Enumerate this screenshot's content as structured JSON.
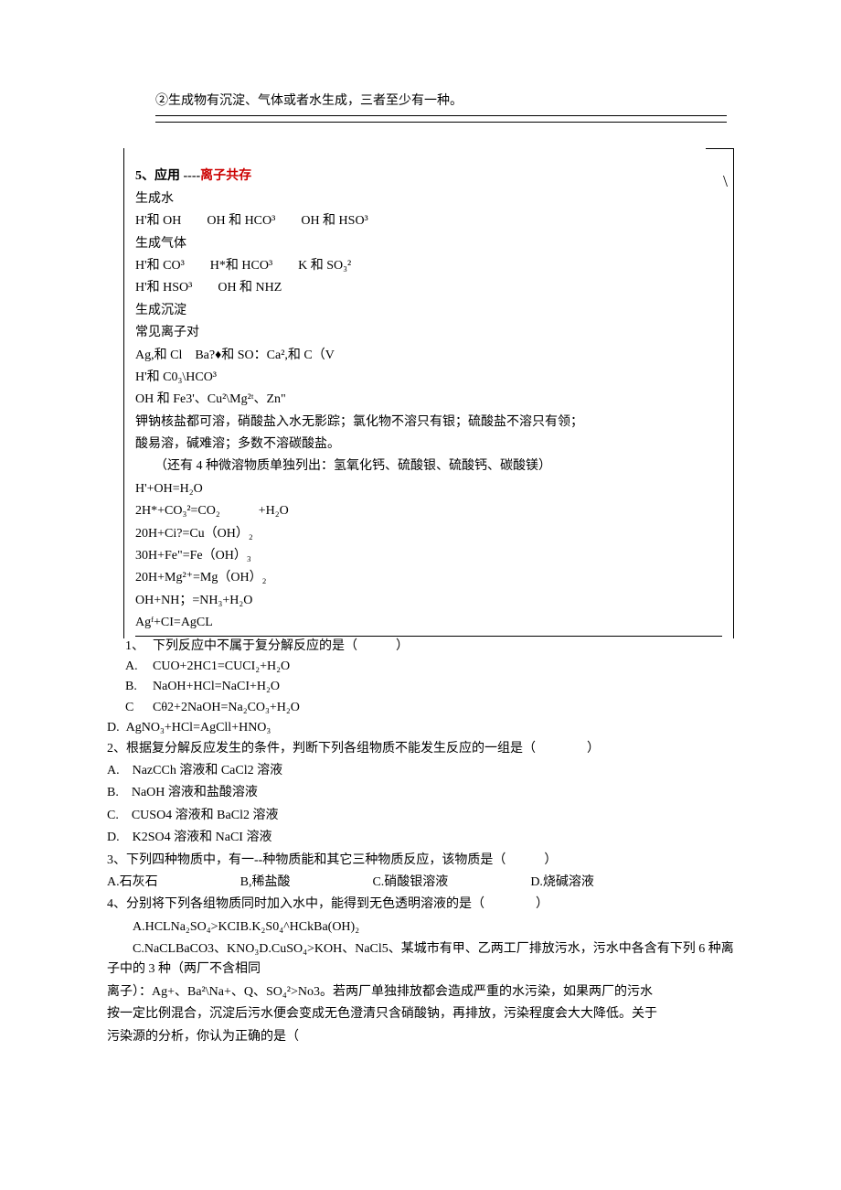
{
  "top_line": "②生成物有沉淀、气体或者水生成，三者至少有一种。",
  "box": {
    "title_prefix": "5、应用 ----",
    "title_red": "离子共存",
    "slash": "\\",
    "l1": "生成水",
    "l2": "H'和 OH　　OH 和 HCO³　　OH 和 HSO³",
    "l3": "生成气体",
    "l4": "H'和 CO³　　H*和 HCO³　　K 和 SO₃²",
    "l5": "H'和 HSO³　　OH 和 NHZ",
    "l6": "生成沉淀",
    "l7": "常见离子对",
    "l8": "Ag,和 Cl　Ba?♦和 SO：Ca²,和 C（V",
    "l9": "H'和 C0₃\\HCO³",
    "l10": "OH 和 Fe3'、Cu²\\Mg²ᵗ、Zn\"",
    "l11": "钾钠核盐都可溶，硝酸盐入水无影踪；氯化物不溶只有银；硫酸盐不溶只有领；",
    "l12": "酸易溶，碱难溶；多数不溶碳酸盐。",
    "l13": "　　（还有 4 种微溶物质单独列出：氢氧化钙、硫酸银、硫酸钙、碳酸镁）",
    "l14": "H'+OH=H₂O",
    "l15": "2H*+CO₃²=CO₂　　　+H₂O",
    "l16": "20H+Ci?=Cu（OH）₂",
    "l17": "30H+Fe\"=Fe（OH）₃",
    "l18": "20H+Mg²⁺=Mg（OH）₂",
    "l19": "OH+NH；=NH₃+H₂O",
    "l20": "Agᶠ+CI=AgCL"
  },
  "q1": {
    "num1": "1、",
    "line1": "下列反应中不属于复分解反应的是（　　　）",
    "numA": "A.",
    "lineA": "CUO+2HC1=CUCI₂+H₂O",
    "numB": "B.",
    "lineB": "NaOH+HCl=NaCI+H₂O",
    "numC": "C",
    "lineC": "Cθ2+2NaOH=Na₂CO₃+H₂O",
    "numD": "D.",
    "lineD": "AgNO₃+HCl=AgCll+HNO₃"
  },
  "q2": {
    "l1": "2、根据复分解反应发生的条件，判断下列各组物质不能发生反应的一组是（　　　　）",
    "l2": "A.　NazCCh 溶液和 CaCl2 溶液",
    "l3": "B.　NaOH 溶液和盐酸溶液",
    "l4": "C.　CUSO4 溶液和 BaCl2 溶液",
    "l5": "D.　K2SO4 溶液和 NaCI 溶液"
  },
  "q3": {
    "l1": "3、下列四种物质中，有一--种物质能和其它三种物质反应，该物质是（　　　）",
    "optA": "A.石灰石",
    "optB": "B,稀盐酸",
    "optC": "C.硝酸银溶液",
    "optD": "D.烧碱溶液"
  },
  "q4": {
    "l1": "4、分别将下列各组物质同时加入水中，能得到无色透明溶液的是（　　　　）",
    "l2": "　　A.HCLNa₂SO₄>KCIB.K₂S0₄^HCkBa(OH)₂",
    "l3": "　　C.NaCLBaCO3、KNO₃D.CuSO₄>KOH、NaCl5、某城市有甲、乙两工厂排放污水，污水中各含有下列 6 种离子中的 3 种（两厂不含相同",
    "l4": "离子）：Ag+、Ba²\\Na+、Q、SO₄²>No3。若两厂单独排放都会造成严重的水污染，如果两厂的污水",
    "l5": "按一定比例混合，沉淀后污水便会变成无色澄清只含硝酸钠，再排放，污染程度会大大降低。关于",
    "l6": "污染源的分析，你认为正确的是（"
  }
}
